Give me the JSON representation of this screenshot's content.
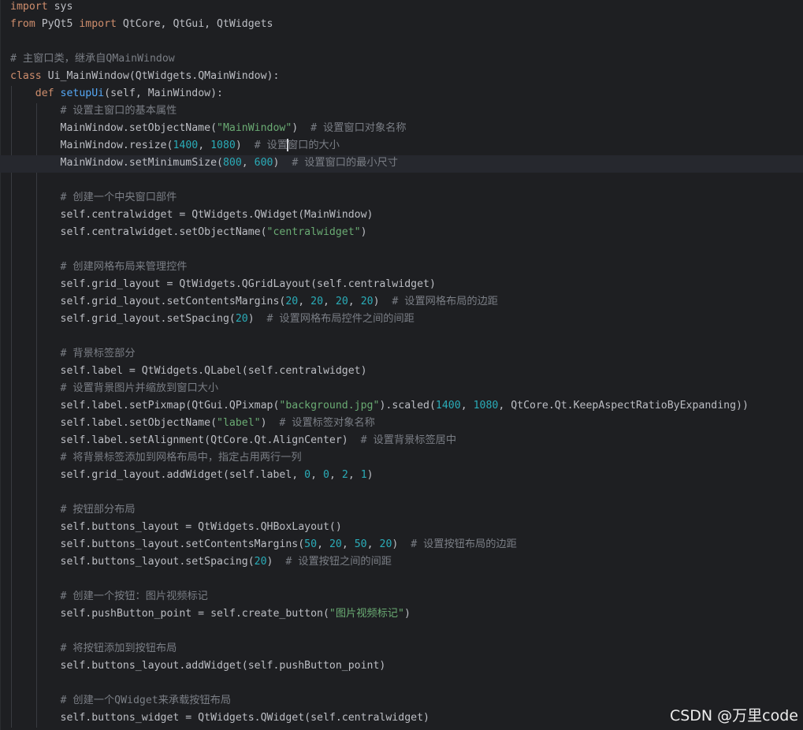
{
  "editor": {
    "cursor_line": 9,
    "lines": [
      [
        [
          "import",
          "kw"
        ],
        [
          " sys",
          ""
        ]
      ],
      [
        [
          "from",
          "kw"
        ],
        [
          " PyQt5 ",
          ""
        ],
        [
          "import",
          "kw"
        ],
        [
          " QtCore, QtGui, QtWidgets",
          ""
        ]
      ],
      [],
      [
        [
          "# 主窗口类，继承自QMainWindow",
          "cmt"
        ]
      ],
      [
        [
          "class",
          "kw"
        ],
        [
          " Ui_MainWindow(QtWidgets.QMainWindow):",
          ""
        ]
      ],
      [
        [
          "    ",
          ""
        ],
        [
          "def",
          "kw"
        ],
        [
          " ",
          ""
        ],
        [
          "setupUi",
          "fn"
        ],
        [
          "(self, MainWindow):",
          ""
        ]
      ],
      [
        [
          "        ",
          ""
        ],
        [
          "# 设置主窗口的基本属性",
          "cmt"
        ]
      ],
      [
        [
          "        MainWindow.setObjectName(",
          ""
        ],
        [
          "\"MainWindow\"",
          "str"
        ],
        [
          ")  ",
          ""
        ],
        [
          "# 设置窗口对象名称",
          "cmt"
        ]
      ],
      [
        [
          "        MainWindow.resize(",
          ""
        ],
        [
          "1400",
          "num"
        ],
        [
          ", ",
          ""
        ],
        [
          "1080",
          "num"
        ],
        [
          ")  ",
          ""
        ],
        [
          "# 设置",
          "cmt"
        ],
        [
          "",
          "caret"
        ],
        [
          "窗口的大小",
          "cmt"
        ]
      ],
      [
        [
          "        MainWindow.setMinimumSize(",
          ""
        ],
        [
          "800",
          "num"
        ],
        [
          ", ",
          ""
        ],
        [
          "600",
          "num"
        ],
        [
          ")  ",
          ""
        ],
        [
          "# 设置窗口的最小尺寸",
          "cmt"
        ]
      ],
      [],
      [
        [
          "        ",
          ""
        ],
        [
          "# 创建一个中央窗口部件",
          "cmt"
        ]
      ],
      [
        [
          "        self.centralwidget = QtWidgets.QWidget(MainWindow)",
          ""
        ]
      ],
      [
        [
          "        self.centralwidget.setObjectName(",
          ""
        ],
        [
          "\"centralwidget\"",
          "str"
        ],
        [
          ")",
          ""
        ]
      ],
      [],
      [
        [
          "        ",
          ""
        ],
        [
          "# 创建网格布局来管理控件",
          "cmt"
        ]
      ],
      [
        [
          "        self.grid_layout = QtWidgets.QGridLayout(self.centralwidget)",
          ""
        ]
      ],
      [
        [
          "        self.grid_layout.setContentsMargins(",
          ""
        ],
        [
          "20",
          "num"
        ],
        [
          ", ",
          ""
        ],
        [
          "20",
          "num"
        ],
        [
          ", ",
          ""
        ],
        [
          "20",
          "num"
        ],
        [
          ", ",
          ""
        ],
        [
          "20",
          "num"
        ],
        [
          ")  ",
          ""
        ],
        [
          "# 设置网格布局的边距",
          "cmt"
        ]
      ],
      [
        [
          "        self.grid_layout.setSpacing(",
          ""
        ],
        [
          "20",
          "num"
        ],
        [
          ")  ",
          ""
        ],
        [
          "# 设置网格布局控件之间的间距",
          "cmt"
        ]
      ],
      [],
      [
        [
          "        ",
          ""
        ],
        [
          "# 背景标签部分",
          "cmt"
        ]
      ],
      [
        [
          "        self.label = QtWidgets.QLabel(self.centralwidget)",
          ""
        ]
      ],
      [
        [
          "        ",
          ""
        ],
        [
          "# 设置背景图片并缩放到窗口大小",
          "cmt"
        ]
      ],
      [
        [
          "        self.label.setPixmap(QtGui.QPixmap(",
          ""
        ],
        [
          "\"background.jpg\"",
          "str"
        ],
        [
          ").scaled(",
          ""
        ],
        [
          "1400",
          "num"
        ],
        [
          ", ",
          ""
        ],
        [
          "1080",
          "num"
        ],
        [
          ", QtCore.Qt.KeepAspectRatioByExpanding))",
          ""
        ]
      ],
      [
        [
          "        self.label.setObjectName(",
          ""
        ],
        [
          "\"label\"",
          "str"
        ],
        [
          ")  ",
          ""
        ],
        [
          "# 设置标签对象名称",
          "cmt"
        ]
      ],
      [
        [
          "        self.label.setAlignment(QtCore.Qt.AlignCenter)  ",
          ""
        ],
        [
          "# 设置背景标签居中",
          "cmt"
        ]
      ],
      [
        [
          "        ",
          ""
        ],
        [
          "# 将背景标签添加到网格布局中，指定占用两行一列",
          "cmt"
        ]
      ],
      [
        [
          "        self.grid_layout.addWidget(self.label, ",
          ""
        ],
        [
          "0",
          "num"
        ],
        [
          ", ",
          ""
        ],
        [
          "0",
          "num"
        ],
        [
          ", ",
          ""
        ],
        [
          "2",
          "num"
        ],
        [
          ", ",
          ""
        ],
        [
          "1",
          "num"
        ],
        [
          ")",
          ""
        ]
      ],
      [],
      [
        [
          "        ",
          ""
        ],
        [
          "# 按钮部分布局",
          "cmt"
        ]
      ],
      [
        [
          "        self.buttons_layout = QtWidgets.QHBoxLayout()",
          ""
        ]
      ],
      [
        [
          "        self.buttons_layout.setContentsMargins(",
          ""
        ],
        [
          "50",
          "num"
        ],
        [
          ", ",
          ""
        ],
        [
          "20",
          "num"
        ],
        [
          ", ",
          ""
        ],
        [
          "50",
          "num"
        ],
        [
          ", ",
          ""
        ],
        [
          "20",
          "num"
        ],
        [
          ")  ",
          ""
        ],
        [
          "# 设置按钮布局的边距",
          "cmt"
        ]
      ],
      [
        [
          "        self.buttons_layout.setSpacing(",
          ""
        ],
        [
          "20",
          "num"
        ],
        [
          ")  ",
          ""
        ],
        [
          "# 设置按钮之间的间距",
          "cmt"
        ]
      ],
      [],
      [
        [
          "        ",
          ""
        ],
        [
          "# 创建一个按钮：图片视频标记",
          "cmt"
        ]
      ],
      [
        [
          "        self.pushButton_point = self.create_button(",
          ""
        ],
        [
          "\"图片视频标记\"",
          "str"
        ],
        [
          ")",
          ""
        ]
      ],
      [],
      [
        [
          "        ",
          ""
        ],
        [
          "# 将按钮添加到按钮布局",
          "cmt"
        ]
      ],
      [
        [
          "        self.buttons_layout.addWidget(self.pushButton_point)",
          ""
        ]
      ],
      [],
      [
        [
          "        ",
          ""
        ],
        [
          "# 创建一个QWidget来承载按钮布局",
          "cmt"
        ]
      ],
      [
        [
          "        self.buttons_widget = QtWidgets.QWidget(self.centralwidget)",
          ""
        ]
      ]
    ]
  },
  "watermark": {
    "text": "CSDN @万里code"
  }
}
